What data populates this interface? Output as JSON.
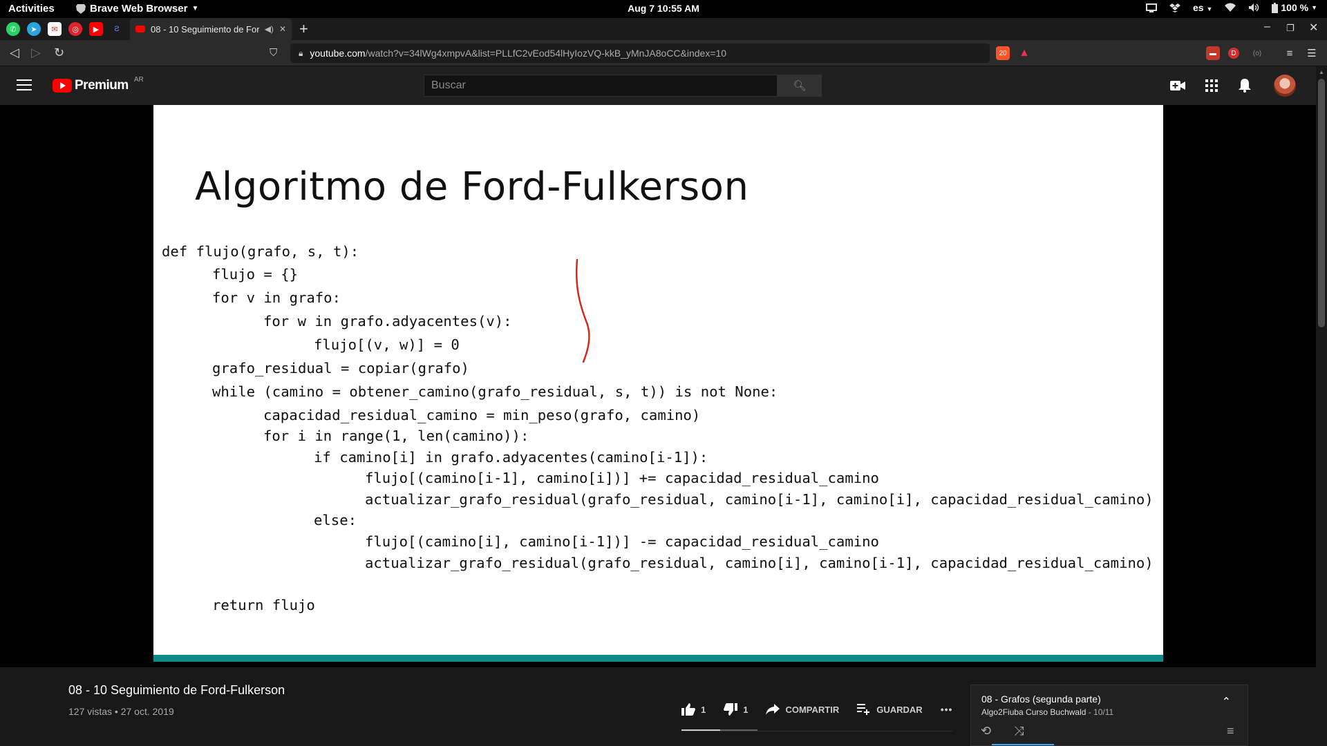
{
  "topbar": {
    "activities": "Activities",
    "app_menu": "Brave Web Browser",
    "clock": "Aug 7  10:55 AM",
    "language": "es",
    "battery": "100 %"
  },
  "browser": {
    "active_tab_title": "08 - 10 Seguimiento de Ford-Fulkerson - YouTube",
    "url_host": "youtube.com",
    "url_path": "/watch?v=34lWg4xmpvA&list=PLLfC2vEod54lHyIozVQ-kkB_yMnJA8oCC&index=10",
    "brave_badge": "20"
  },
  "youtube": {
    "logo_text": "Premium",
    "country_code": "AR",
    "search_placeholder": "Buscar"
  },
  "slide": {
    "title": "Algoritmo de Ford-Fulkerson",
    "code_lines": [
      "def flujo(grafo, s, t):",
      "flujo = {}",
      "for v in grafo:",
      "for w in grafo.adyacentes(v):",
      "flujo[(v, w)] = 0",
      "grafo_residual = copiar(grafo)",
      "while (camino = obtener_camino(grafo_residual, s, t)) is not None:",
      "capacidad_residual_camino = min_peso(grafo, camino)",
      "for i in range(1, len(camino)):",
      "if camino[i] in grafo.adyacentes(camino[i-1]):",
      "flujo[(camino[i-1], camino[i])] += capacidad_residual_camino",
      "actualizar_grafo_residual(grafo_residual, camino[i-1], camino[i], capacidad_residual_camino)",
      "else:",
      "flujo[(camino[i], camino[i-1])] -= capacidad_residual_camino",
      "actualizar_grafo_residual(grafo_residual, camino[i], camino[i-1], capacidad_residual_camino)",
      "return flujo"
    ],
    "accent_color": "#0f8a88",
    "annotation_color": "#d42a1e"
  },
  "video": {
    "title": "08 - 10 Seguimiento de Ford-Fulkerson",
    "meta": "127 vistas • 27 oct. 2019",
    "likes": "1",
    "dislikes": "1",
    "share_label": "COMPARTIR",
    "save_label": "GUARDAR",
    "more_label": "•••"
  },
  "playlist": {
    "title": "08 - Grafos (segunda parte)",
    "channel": "Algo2Fiuba Curso Buchwald",
    "position": " - 10/11"
  }
}
